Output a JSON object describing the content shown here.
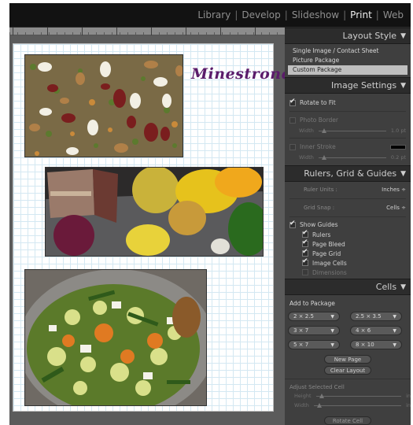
{
  "modules": {
    "items": [
      "Library",
      "Develop",
      "Slideshow",
      "Print",
      "Web"
    ],
    "separator": "|",
    "active": "Print"
  },
  "page": {
    "title": "Minestrone"
  },
  "layout_style": {
    "header": "Layout Style",
    "items": [
      "Single Image / Contact Sheet",
      "Picture Package",
      "Custom Package"
    ],
    "selected": "Custom Package"
  },
  "image_settings": {
    "header": "Image Settings",
    "rotate_to_fit": "Rotate to Fit",
    "photo_border": "Photo Border",
    "width_label": "Width",
    "border_width_value": "1.0 pt",
    "inner_stroke": "Inner Stroke",
    "stroke_width_value": "0.2 pt"
  },
  "rulers": {
    "header": "Rulers, Grid & Guides",
    "ruler_units_label": "Ruler Units :",
    "ruler_units_value": "Inches ÷",
    "grid_snap_label": "Grid Snap :",
    "grid_snap_value": "Cells ÷",
    "show_guides": "Show Guides",
    "guides": [
      "Rulers",
      "Page Bleed",
      "Page Grid",
      "Image Cells",
      "Dimensions"
    ]
  },
  "cells": {
    "header": "Cells",
    "add_to_package": "Add to Package",
    "sizes": [
      "2 × 2.5",
      "2.5 × 3.5",
      "3 × 7",
      "4 × 6",
      "5 × 7",
      "8 × 10"
    ],
    "new_page": "New Page",
    "clear_layout": "Clear Layout",
    "adjust_selected": "Adjust Selected Cell",
    "height_label": "Height",
    "width_label": "Width",
    "unit": "in",
    "rotate_cell": "Rotate Cell"
  },
  "colors": {
    "title": "#5a1b6a",
    "panel_bg": "#3f3f3f",
    "header_bg": "#2c2c2c",
    "selected_item": "#bfbfbf"
  },
  "icons": {
    "collapse": "triangle-down-icon",
    "check": "checkmark-icon",
    "dropdown": "chevron-down-icon"
  }
}
